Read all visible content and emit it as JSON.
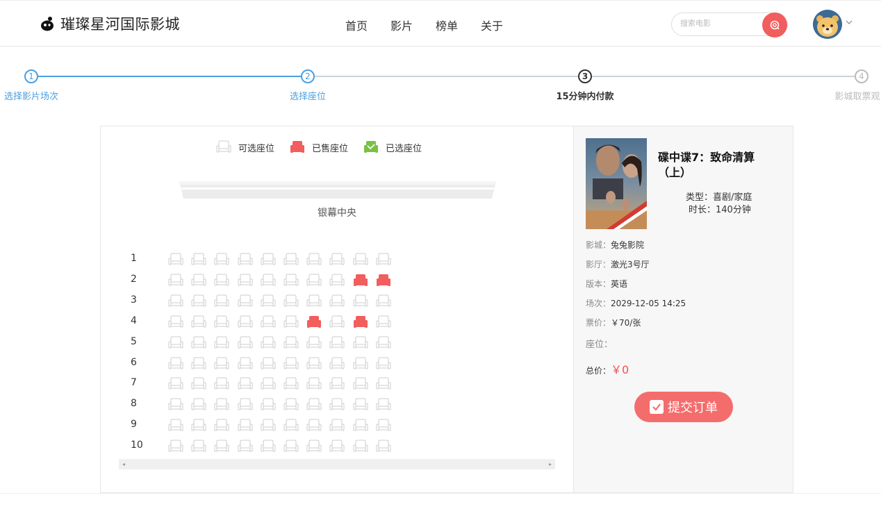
{
  "header": {
    "logo_text": "璀璨星河国际影城",
    "nav": [
      "首页",
      "影片",
      "榜单",
      "关于"
    ],
    "search_placeholder": "搜索电影"
  },
  "steps": [
    {
      "num": "1",
      "label": "选择影片场次",
      "state": "done"
    },
    {
      "num": "2",
      "label": "选择座位",
      "state": "done"
    },
    {
      "num": "3",
      "label": "15分钟内付款",
      "state": "current"
    },
    {
      "num": "4",
      "label": "影城取票观",
      "state": "todo"
    }
  ],
  "colors": {
    "accent_blue": "#4a9fe0",
    "sold_red": "#f25d5d",
    "selected_green": "#7bc043",
    "price_red": "#f05050"
  },
  "legend": {
    "available": "可选座位",
    "sold": "已售座位",
    "selected": "已选座位"
  },
  "screen_label": "银幕中央",
  "seat_map": {
    "rows": [
      "1",
      "2",
      "3",
      "4",
      "5",
      "6",
      "7",
      "8",
      "9",
      "10"
    ],
    "cols": 10,
    "sold": [
      [
        2,
        9
      ],
      [
        2,
        10
      ],
      [
        4,
        7
      ],
      [
        4,
        9
      ]
    ]
  },
  "movie": {
    "title": "碟中谍7：致命清算（上）",
    "genre_label": "类型：",
    "genre": "喜剧/家庭",
    "duration_label": "时长：",
    "duration": "140分钟"
  },
  "order": {
    "cinema_label": "影城：",
    "cinema": "兔兔影院",
    "hall_label": "影厅：",
    "hall": "激光3号厅",
    "version_label": "版本：",
    "version": "英语",
    "session_label": "场次：",
    "session": "2029-12-05 14:25",
    "price_label": "票价：",
    "price": "￥70/张",
    "seats_label": "座位：",
    "total_label": "总价：",
    "total": "￥0"
  },
  "submit_label": "提交订单"
}
